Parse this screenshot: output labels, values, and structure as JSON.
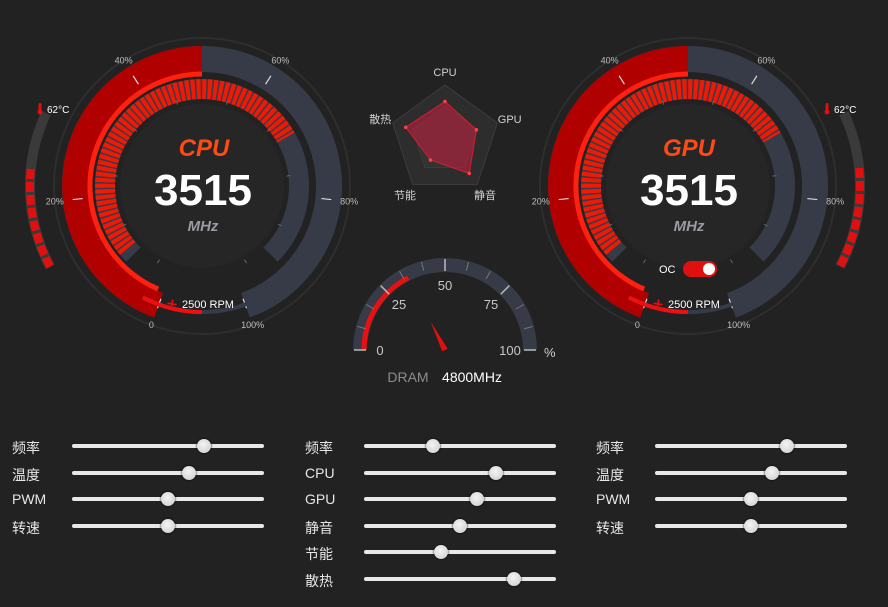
{
  "cpu_gauge": {
    "title": "CPU",
    "value": "3515",
    "unit": "MHz",
    "ticks": [
      "0",
      "20%",
      "40%",
      "60%",
      "80%",
      "100%"
    ],
    "temp_value": "62",
    "temp_unit": "°C",
    "fan_value": "2500",
    "fan_unit": "RPM"
  },
  "gpu_gauge": {
    "title": "GPU",
    "value": "3515",
    "unit": "MHz",
    "ticks": [
      "0",
      "20%",
      "40%",
      "60%",
      "80%",
      "100%"
    ],
    "temp_value": "62",
    "temp_unit": "°C",
    "fan_value": "2500",
    "fan_unit": "RPM",
    "oc_label": "OC",
    "oc_on": true
  },
  "radar": {
    "axes": [
      "CPU",
      "GPU",
      "静音",
      "节能",
      "散热"
    ],
    "values": [
      0.7,
      0.6,
      0.75,
      0.45,
      0.75
    ]
  },
  "dram_gauge": {
    "ticks": [
      "0",
      "25",
      "50",
      "75",
      "100"
    ],
    "unit": "%",
    "label": "DRAM",
    "value": "4800MHz",
    "level_percent": 35
  },
  "colors": {
    "accent": "#e01010",
    "title": "#ff4a12",
    "track": "#373b47",
    "background": "#222222"
  },
  "slider_groups": [
    {
      "items": [
        {
          "label": "频率",
          "value": 0.69
        },
        {
          "label": "温度",
          "value": 0.61
        },
        {
          "label": "PWM",
          "value": 0.5
        },
        {
          "label": "转速",
          "value": 0.5
        }
      ]
    },
    {
      "items": [
        {
          "label": "频率",
          "value": 0.36
        },
        {
          "label": "CPU",
          "value": 0.69
        },
        {
          "label": "GPU",
          "value": 0.59
        },
        {
          "label": "静音",
          "value": 0.5
        },
        {
          "label": "节能",
          "value": 0.4
        },
        {
          "label": "散热",
          "value": 0.78
        }
      ]
    },
    {
      "items": [
        {
          "label": "频率",
          "value": 0.69
        },
        {
          "label": "温度",
          "value": 0.61
        },
        {
          "label": "PWM",
          "value": 0.5
        },
        {
          "label": "转速",
          "value": 0.5
        }
      ]
    }
  ]
}
